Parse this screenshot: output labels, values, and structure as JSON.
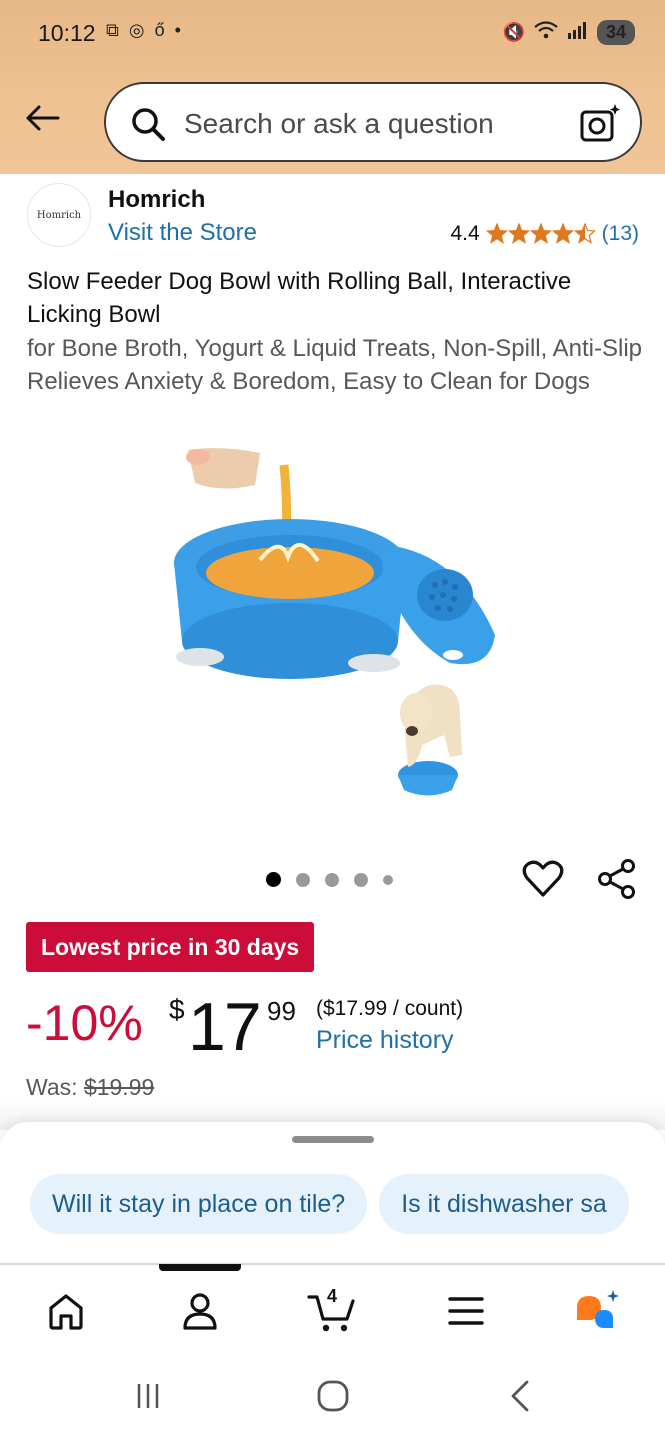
{
  "status_bar": {
    "time": "10:12",
    "battery": "34"
  },
  "search": {
    "placeholder": "Search or ask a question"
  },
  "brand": {
    "logo_text": "Homrich",
    "name": "Homrich",
    "store_link": "Visit the Store"
  },
  "rating": {
    "value": "4.4",
    "stars": 4.5,
    "count": "(13)"
  },
  "product": {
    "title": "Slow Feeder Dog Bowl with Rolling Ball, Interactive Licking Bowl",
    "subtitle": "for Bone Broth, Yogurt & Liquid Treats, Non-Spill, Anti-Slip Relieves Anxiety & Boredom, Easy to Clean for Dogs",
    "image_count": 5,
    "active_image": 1
  },
  "deal": {
    "badge": "Lowest price in 30 days"
  },
  "price": {
    "discount": "-10%",
    "currency": "$",
    "whole": "17",
    "fraction": "99",
    "unit_price": "($17.99 / count)",
    "history_link": "Price history",
    "was_label": "Was:",
    "was_price": "$19.99"
  },
  "suggestions": [
    "Will it stay in place on tile?",
    "Is it dishwasher sa"
  ],
  "bottom_nav": {
    "cart_count": "4",
    "items": [
      "home-icon",
      "account-icon",
      "cart-icon",
      "menu-icon",
      "rufus-icon"
    ]
  },
  "colors": {
    "header": "#efc293",
    "link": "#1f6fa8",
    "deal_red": "#cc0c39",
    "star": "#de7921",
    "chip_bg": "#e6f2fb"
  }
}
